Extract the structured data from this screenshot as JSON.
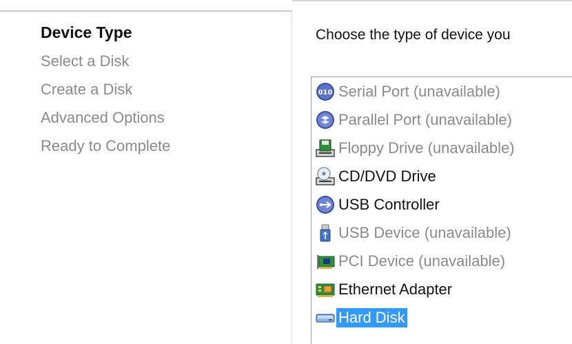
{
  "wizard": {
    "steps": [
      {
        "label": "Device Type",
        "active": true
      },
      {
        "label": "Select a Disk",
        "active": false
      },
      {
        "label": "Create a Disk",
        "active": false
      },
      {
        "label": "Advanced Options",
        "active": false
      },
      {
        "label": "Ready to Complete",
        "active": false
      }
    ]
  },
  "main": {
    "instruction": "Choose the type of device you",
    "devices": [
      {
        "label": "Serial Port (unavailable)",
        "icon": "serial-port-icon",
        "available": false,
        "selected": false
      },
      {
        "label": "Parallel Port (unavailable)",
        "icon": "parallel-port-icon",
        "available": false,
        "selected": false
      },
      {
        "label": "Floppy Drive (unavailable)",
        "icon": "floppy-drive-icon",
        "available": false,
        "selected": false
      },
      {
        "label": "CD/DVD Drive",
        "icon": "cd-dvd-drive-icon",
        "available": true,
        "selected": false
      },
      {
        "label": "USB Controller",
        "icon": "usb-controller-icon",
        "available": true,
        "selected": false
      },
      {
        "label": "USB Device (unavailable)",
        "icon": "usb-device-icon",
        "available": false,
        "selected": false
      },
      {
        "label": "PCI Device (unavailable)",
        "icon": "pci-device-icon",
        "available": false,
        "selected": false
      },
      {
        "label": "Ethernet Adapter",
        "icon": "ethernet-adapter-icon",
        "available": true,
        "selected": false
      },
      {
        "label": "Hard Disk",
        "icon": "hard-disk-icon",
        "available": true,
        "selected": true
      }
    ]
  },
  "colors": {
    "selection": "#3399ff",
    "disabled_text": "#8a8a8a",
    "text": "#111111"
  }
}
